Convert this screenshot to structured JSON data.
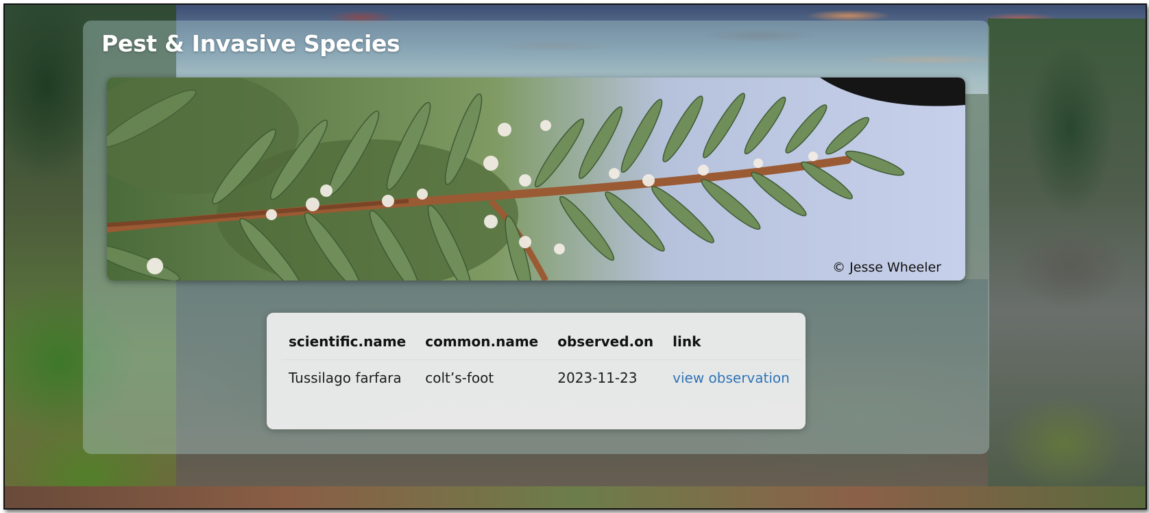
{
  "page": {
    "title": "Pest & Invasive Species"
  },
  "hero": {
    "image": "hemlock-branch-photo",
    "credit": "© Jesse Wheeler"
  },
  "table": {
    "headers": [
      "scientific.name",
      "common.name",
      "observed.on",
      "link"
    ],
    "rows": [
      {
        "scientific_name": "Tussilago farfara",
        "common_name": "colt’s-foot",
        "observed_on": "2023-11-23",
        "link_text": "view observation"
      }
    ]
  },
  "colors": {
    "panel": "#aac8c8",
    "link": "#2f74b5",
    "title": "#ffffff"
  }
}
